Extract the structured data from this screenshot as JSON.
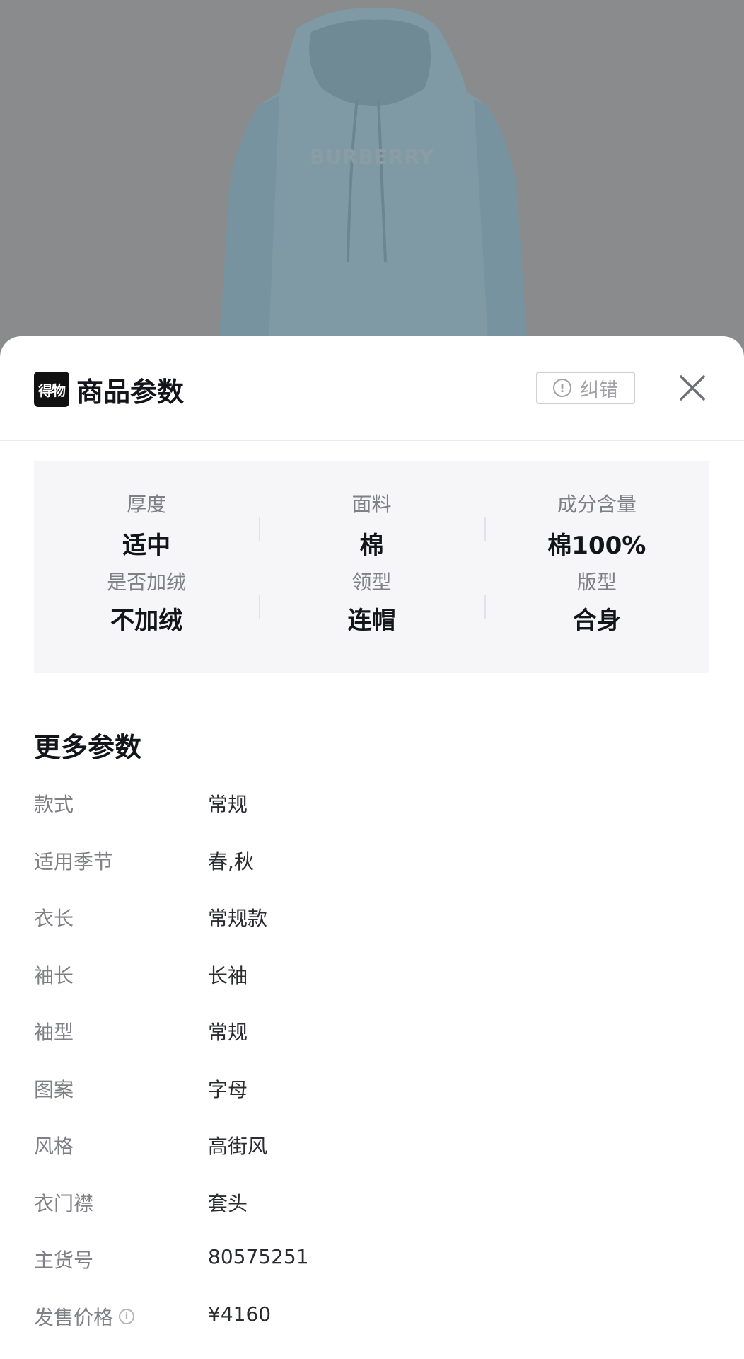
{
  "backdrop": {
    "brand_print": "BURBERRY"
  },
  "sheet": {
    "logo_text": "得物",
    "title": "商品参数",
    "report_label": "纠错",
    "key_params": [
      {
        "label": "厚度",
        "value": "适中"
      },
      {
        "label": "面料",
        "value": "棉"
      },
      {
        "label": "成分含量",
        "value": "棉100%"
      },
      {
        "label": "是否加绒",
        "value": "不加绒"
      },
      {
        "label": "领型",
        "value": "连帽"
      },
      {
        "label": "版型",
        "value": "合身"
      }
    ],
    "more_title": "更多参数",
    "more_params": [
      {
        "label": "款式",
        "value": "常规"
      },
      {
        "label": "适用季节",
        "value": "春,秋"
      },
      {
        "label": "衣长",
        "value": "常规款"
      },
      {
        "label": "袖长",
        "value": "长袖"
      },
      {
        "label": "袖型",
        "value": "常规"
      },
      {
        "label": "图案",
        "value": "字母"
      },
      {
        "label": "风格",
        "value": "高街风"
      },
      {
        "label": "衣门襟",
        "value": "套头"
      },
      {
        "label": "主货号",
        "value": "80575251"
      },
      {
        "label": "发售价格",
        "value": "¥4160"
      }
    ]
  },
  "icons": {
    "logo": "brand-logo-icon",
    "report": "alert-circle-icon",
    "close": "close-icon",
    "info": "info-icon"
  }
}
